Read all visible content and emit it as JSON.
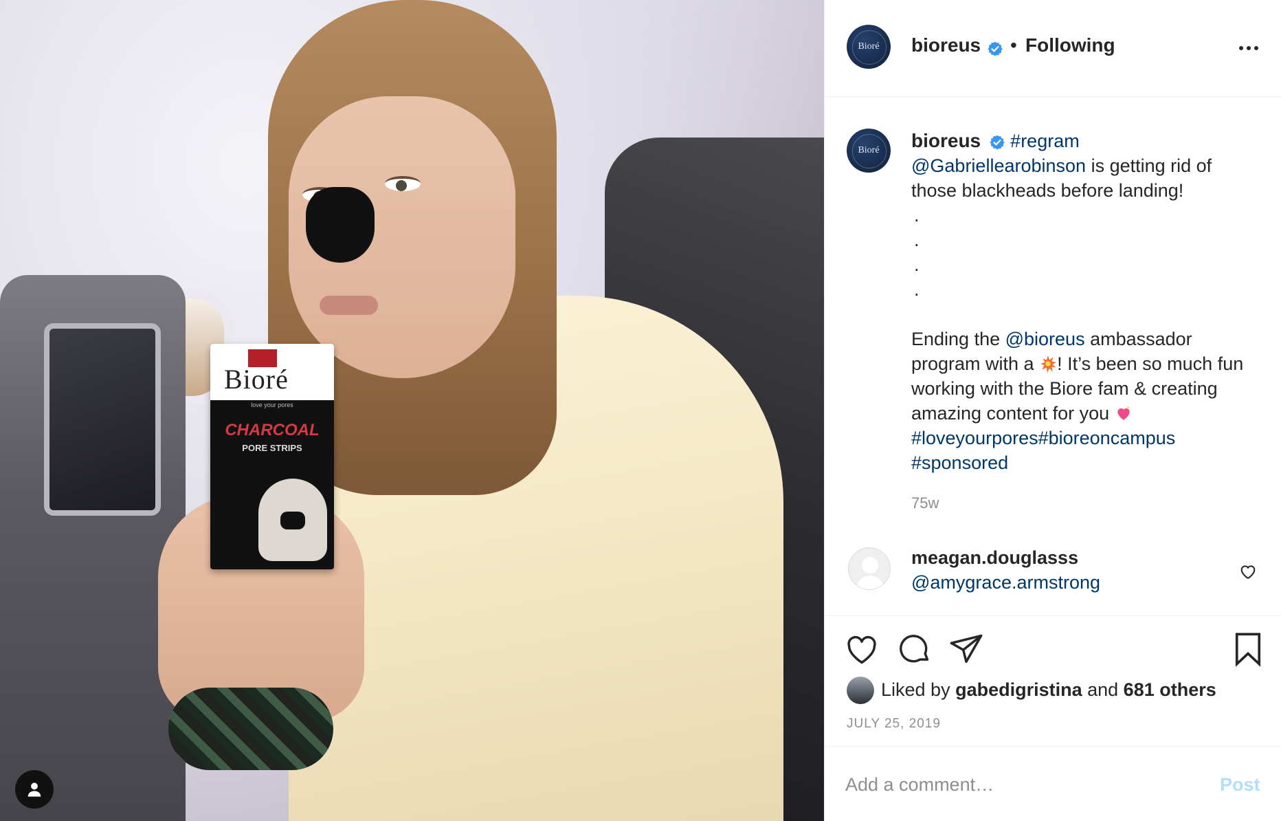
{
  "account": {
    "username": "bioreus",
    "avatar_text": "Bioré",
    "follow_state": "Following",
    "separator": "•"
  },
  "photo": {
    "pack_brand": "Bioré",
    "pack_tagline": "love your pores",
    "pack_product": "CHARCOAL",
    "pack_subtitle": "PORE STRIPS"
  },
  "caption": {
    "hashtag_regram": "#regram",
    "mention": "@Gabriellearobinson",
    "line1_rest": " is getting rid of those blackheads before landing!",
    "dots": [
      ".",
      ".",
      ".",
      "."
    ],
    "para2_a": "Ending the ",
    "para2_mention": "@bioreus",
    "para2_b": " ambassador program with a ",
    "para2_c": "! It’s been so much fun working with the Biore fam & creating amazing content for you ",
    "tags_line1": "#loveyourpores#bioreoncampus",
    "tags_line2": "#sponsored",
    "age": "75w"
  },
  "comment": {
    "username": "meagan.douglasss",
    "text": "@amygrace.armstrong"
  },
  "likes": {
    "prefix": "Liked by ",
    "first_user": "gabedigristina",
    "middle": " and ",
    "others": "681 others"
  },
  "date": "JULY 25, 2019",
  "composer": {
    "placeholder": "Add a comment…",
    "post_label": "Post"
  },
  "colors": {
    "link": "#00376b",
    "verified": "#3897f0",
    "muted": "#8e8e8e",
    "post_disabled": "#b2dffc"
  },
  "icons": [
    "verified-badge-icon",
    "more-options-icon",
    "heart-icon",
    "comment-icon",
    "share-icon",
    "bookmark-icon",
    "user-tag-icon",
    "collision-emoji",
    "sparkling-heart-emoji"
  ]
}
